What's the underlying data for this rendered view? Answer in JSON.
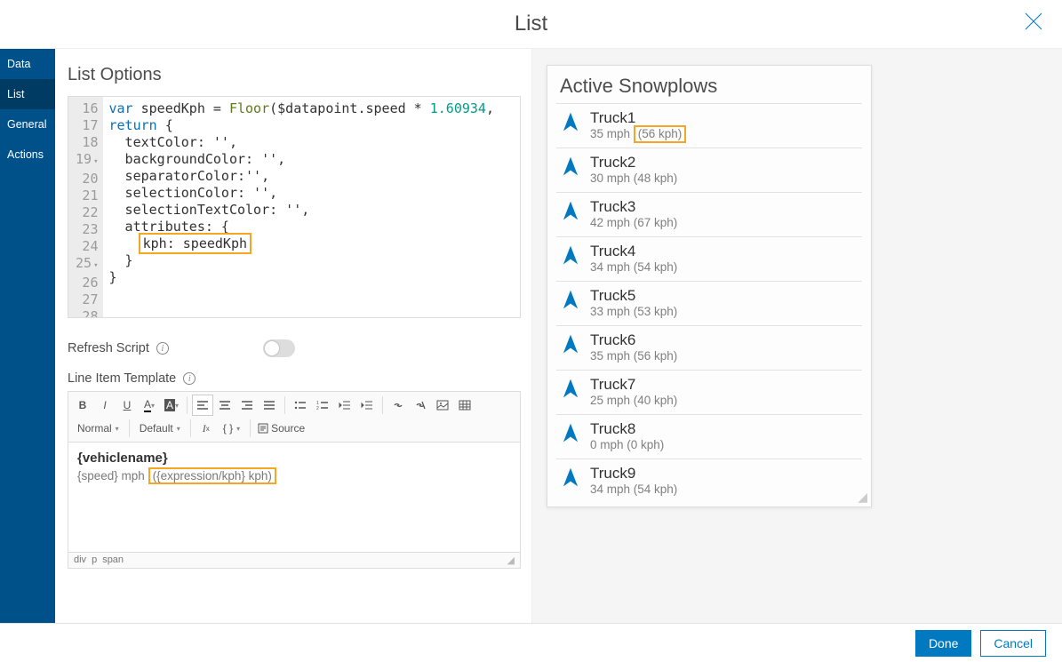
{
  "dialog": {
    "title": "List"
  },
  "sidebar": {
    "tabs": [
      {
        "id": "data",
        "label": "Data"
      },
      {
        "id": "list",
        "label": "List"
      },
      {
        "id": "general",
        "label": "General"
      },
      {
        "id": "actions",
        "label": "Actions"
      }
    ],
    "active": "list"
  },
  "config": {
    "heading": "List Options",
    "code": {
      "lines": [
        {
          "n": 16,
          "text": ""
        },
        {
          "n": 17,
          "html": "<span class='kw'>var</span> speedKph = <span class='fn'>Floor</span>($datapoint.speed * <span class='num'>1.60934</span>,"
        },
        {
          "n": 18,
          "text": ""
        },
        {
          "n": 19,
          "html": "<span class='kw'>return</span> {",
          "fold": true
        },
        {
          "n": 20,
          "text": "  textColor: '',"
        },
        {
          "n": 21,
          "text": "  backgroundColor: '',"
        },
        {
          "n": 22,
          "text": "  separatorColor:'',"
        },
        {
          "n": 23,
          "text": "  selectionColor: '',"
        },
        {
          "n": 24,
          "text": "  selectionTextColor: '',"
        },
        {
          "n": 25,
          "text": "  attributes: {",
          "fold": true
        },
        {
          "n": 26,
          "html": "    <span class='hl'>kph: speedKph</span>"
        },
        {
          "n": 27,
          "text": "  }"
        },
        {
          "n": 28,
          "text": "}"
        }
      ]
    },
    "refresh_label": "Refresh Script",
    "template_label": "Line Item Template",
    "toolbar": {
      "bold": "B",
      "italic": "I",
      "underline": "U",
      "fontcolor": "A",
      "bgcolor": "A",
      "normal": "Normal",
      "default": "Default",
      "clear": "I",
      "clear_sub": "x",
      "braces": "{ }",
      "source": "Source"
    },
    "template_body": {
      "line1": "{vehiclename}",
      "line2_pre": "{speed} mph ",
      "line2_hl": "({expression/kph} kph)"
    },
    "breadcrumb": [
      "div",
      "p",
      "span"
    ]
  },
  "preview": {
    "title": "Active Snowplows",
    "items": [
      {
        "name": "Truck1",
        "mph": 35,
        "kph": 56,
        "hl": true
      },
      {
        "name": "Truck2",
        "mph": 30,
        "kph": 48
      },
      {
        "name": "Truck3",
        "mph": 42,
        "kph": 67
      },
      {
        "name": "Truck4",
        "mph": 34,
        "kph": 54
      },
      {
        "name": "Truck5",
        "mph": 33,
        "kph": 53
      },
      {
        "name": "Truck6",
        "mph": 35,
        "kph": 56
      },
      {
        "name": "Truck7",
        "mph": 25,
        "kph": 40
      },
      {
        "name": "Truck8",
        "mph": 0,
        "kph": 0
      },
      {
        "name": "Truck9",
        "mph": 34,
        "kph": 54
      }
    ]
  },
  "footer": {
    "done": "Done",
    "cancel": "Cancel"
  }
}
